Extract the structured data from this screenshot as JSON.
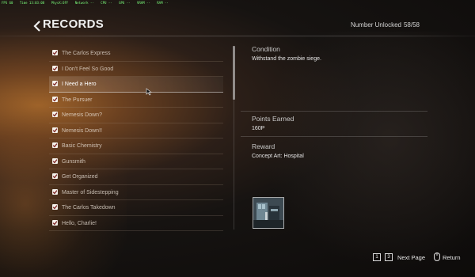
{
  "debug": [
    "FPS 60",
    "Time 13:03:08",
    "PhysX:OFF",
    "Network --",
    "CPU --",
    "GPU --",
    "VRAM --",
    "RAM --"
  ],
  "header": {
    "title": "RECORDS",
    "unlocked_label": "Number Unlocked",
    "unlocked_value": "58/58"
  },
  "records": [
    {
      "label": "The Carlos Express",
      "checked": true
    },
    {
      "label": "I Don't Feel So Good",
      "checked": true
    },
    {
      "label": "I Need a Hero",
      "checked": true,
      "selected": true
    },
    {
      "label": "The Pursuer",
      "checked": true
    },
    {
      "label": "Nemesis Down?",
      "checked": true
    },
    {
      "label": "Nemesis Down!!",
      "checked": true
    },
    {
      "label": "Basic Chemistry",
      "checked": true
    },
    {
      "label": "Gunsmith",
      "checked": true
    },
    {
      "label": "Get Organized",
      "checked": true
    },
    {
      "label": "Master of Sidestepping",
      "checked": true
    },
    {
      "label": "The Carlos Takedown",
      "checked": true
    },
    {
      "label": "Hello, Charlie!",
      "checked": true
    }
  ],
  "detail": {
    "condition_title": "Condition",
    "condition_value": "Withstand the zombie siege.",
    "points_title": "Points Earned",
    "points_value": "160P",
    "reward_title": "Reward",
    "reward_value": "Concept Art: Hospital",
    "reward_thumbnail": "hospital-concept-art"
  },
  "footer": {
    "key1": "1",
    "key2": "3",
    "next_page_label": "Next Page",
    "return_label": "Return",
    "return_icon": "mouse-icon"
  },
  "colors": {
    "accent": "#ffffff",
    "checkbox": "#f4f0ea",
    "text_dim": "#d4d4d4"
  }
}
